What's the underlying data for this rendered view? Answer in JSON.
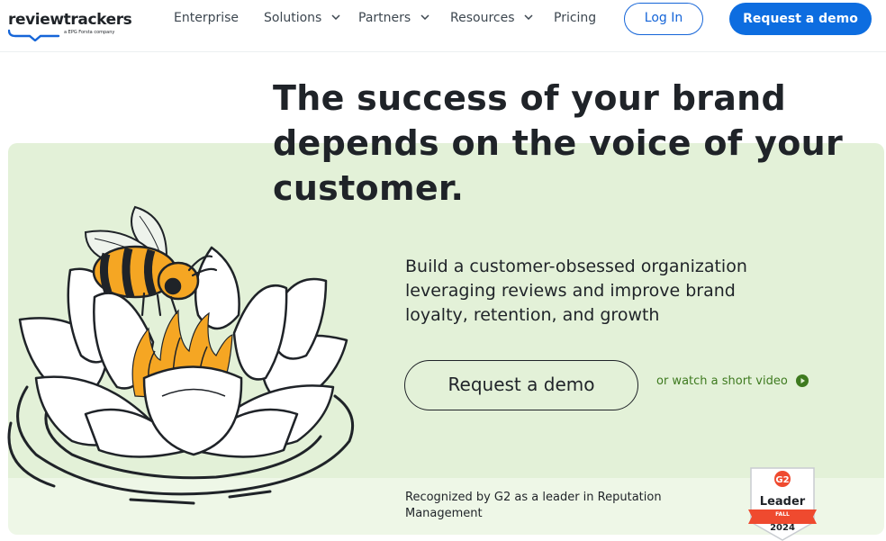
{
  "brand": {
    "name": "reviewtrackers",
    "tagline": "a EPG Forsta company",
    "accent_color": "#0d6de0",
    "hero_color": "#e3f1d8"
  },
  "nav": {
    "items": [
      {
        "label": "Enterprise",
        "has_dropdown": false
      },
      {
        "label": "Solutions",
        "has_dropdown": true
      },
      {
        "label": "Partners",
        "has_dropdown": true
      },
      {
        "label": "Resources",
        "has_dropdown": true
      },
      {
        "label": "Pricing",
        "has_dropdown": false
      }
    ],
    "login_label": "Log In",
    "demo_label": "Request a demo"
  },
  "hero": {
    "headline_lines": [
      "The success of your brand",
      "depends on the voice of your",
      "customer."
    ],
    "subcopy_lines": [
      "Build a customer-obsessed organization",
      "leveraging reviews and improve brand",
      "loyalty, retention, and growth"
    ],
    "cta_label": "Request a demo",
    "video_label": "or watch a short video",
    "illustration": "bee-on-water-lily"
  },
  "recognition": {
    "text_lines": [
      "Recognized by G2 as a leader in Reputation",
      "Management"
    ],
    "badge": {
      "logo": "G2",
      "title": "Leader",
      "season": "FALL",
      "year": "2024"
    }
  }
}
